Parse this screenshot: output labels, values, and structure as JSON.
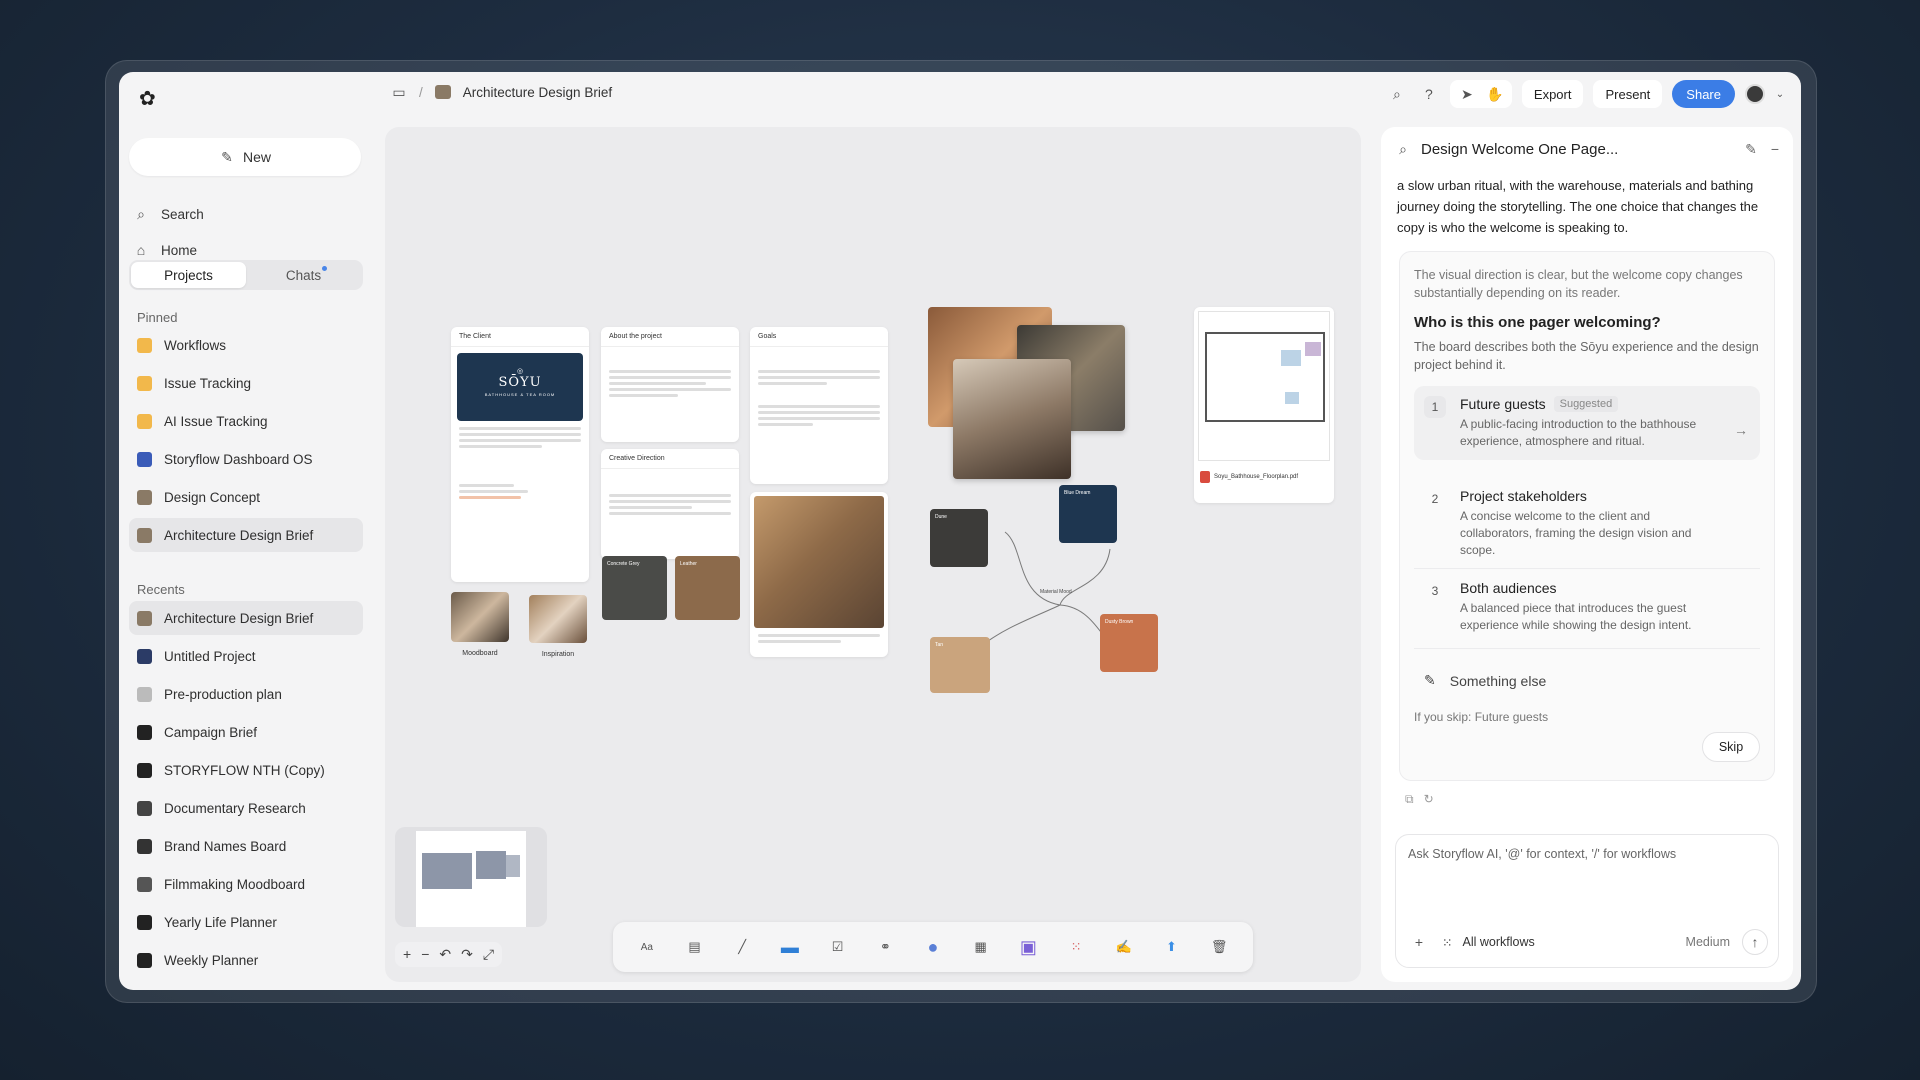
{
  "app": {
    "logo_icon": "flower-logo-icon"
  },
  "sidebar": {
    "new_label": "New",
    "search_label": "Search",
    "home_label": "Home",
    "tabs": [
      {
        "label": "Projects",
        "active": true
      },
      {
        "label": "Chats",
        "active": false,
        "has_dot": true
      }
    ],
    "pinned_label": "Pinned",
    "pinned": [
      {
        "label": "Workflows",
        "icon": "folder-icon",
        "color": "#f2b84b"
      },
      {
        "label": "Issue Tracking",
        "icon": "folder-icon",
        "color": "#f2b84b"
      },
      {
        "label": "AI Issue Tracking",
        "icon": "folder-icon",
        "color": "#f2b84b"
      },
      {
        "label": "Storyflow Dashboard OS",
        "icon": "globe-icon",
        "color": "#3a5bb8"
      },
      {
        "label": "Design Concept",
        "icon": "image-icon",
        "color": "#8a7a66"
      },
      {
        "label": "Architecture Design Brief",
        "icon": "image-icon",
        "color": "#8a7a66"
      }
    ],
    "recents_label": "Recents",
    "recents": [
      {
        "label": "Architecture Design Brief",
        "color": "#8a7a66"
      },
      {
        "label": "Untitled Project",
        "color": "#2b3b66"
      },
      {
        "label": "Pre-production plan",
        "color": "#bbbbbb"
      },
      {
        "label": "Campaign Brief",
        "color": "#222222"
      },
      {
        "label": "STORYFLOW NTH (Copy)",
        "color": "#222222"
      },
      {
        "label": "Documentary Research",
        "color": "#444444"
      },
      {
        "label": "Brand Names Board",
        "color": "#333333"
      },
      {
        "label": "Filmmaking Moodboard",
        "color": "#555555"
      },
      {
        "label": "Yearly Life Planner",
        "color": "#222222"
      },
      {
        "label": "Weekly Planner",
        "color": "#222222"
      }
    ]
  },
  "topbar": {
    "doc_title": "Architecture Design Brief",
    "export_label": "Export",
    "present_label": "Present",
    "share_label": "Share"
  },
  "canvas": {
    "cards": {
      "client_title": "The Client",
      "brand_name": "SŌYU",
      "brand_sub": "BATHHOUSE & TEA ROOM",
      "about_title": "About the project",
      "goals_title": "Goals",
      "creative_title": "Creative Direction",
      "moodboard_label": "Moodboard",
      "inspiration_label": "Inspiration",
      "swatch1": "Concrete Grey",
      "swatch2": "Leather",
      "swatch3": "Dune",
      "swatch4": "Blue Dream",
      "swatch5": "Tan",
      "swatch6": "Dusty Brown",
      "material_node": "Material Mood",
      "pdf_name": "Soyu_Bathhouse_Floorplan.pdf"
    },
    "toolbar_items": [
      "text-tool-icon",
      "card-tool-icon",
      "line-tool-icon",
      "folder-tool-icon",
      "checklist-tool-icon",
      "link-tool-icon",
      "shape-tool-icon",
      "table-tool-icon",
      "image-tool-icon",
      "apps-tool-icon",
      "draw-tool-icon",
      "upload-tool-icon",
      "trash-icon"
    ],
    "text_tool_label": "Aa"
  },
  "panel": {
    "title": "Design Welcome One Page...",
    "intro": "a slow urban ritual, with the warehouse, materials and bathing journey doing the storytelling. The one choice that changes the copy is who the welcome is speaking to.",
    "context": "The visual direction is clear, but the welcome copy changes substantially depending on its reader.",
    "question": "Who is this one pager welcoming?",
    "question_desc": "The board describes both the Sōyu experience and the design project behind it.",
    "options": [
      {
        "num": "1",
        "title": "Future guests",
        "badge": "Suggested",
        "desc": "A public-facing introduction to the bathhouse experience, atmosphere and ritual."
      },
      {
        "num": "2",
        "title": "Project stakeholders",
        "desc": "A concise welcome to the client and collaborators, framing the design vision and scope."
      },
      {
        "num": "3",
        "title": "Both audiences",
        "desc": "A balanced piece that introduces the guest experience while showing the design intent."
      }
    ],
    "something_else": "Something else",
    "skip_note": "If you skip: Future guests",
    "skip_label": "Skip",
    "composer_placeholder": "Ask Storyflow AI, '@' for context, '/' for workflows",
    "workflows_label": "All workflows",
    "effort_label": "Medium"
  }
}
